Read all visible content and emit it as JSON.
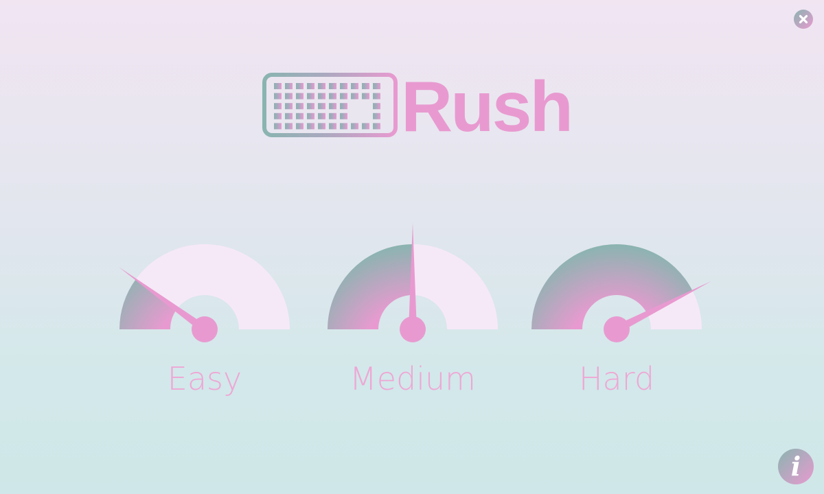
{
  "app": {
    "title": "Rush"
  },
  "colors": {
    "background_top": "#f1e5f2",
    "background_bottom": "#cfe7e8",
    "accent_pink": "#e89ad0",
    "accent_teal": "#8ab4b0",
    "track": "#f6e9f7",
    "label": "#efa6d5"
  },
  "toolbar": {
    "close_icon": "close-icon",
    "info_icon": "info-icon",
    "info_glyph": "i"
  },
  "logo": {
    "icon": "keyboard-icon",
    "text": "Rush"
  },
  "difficulty": {
    "levels": [
      {
        "label": "Easy",
        "level_fraction": 0.2
      },
      {
        "label": "Medium",
        "level_fraction": 0.5
      },
      {
        "label": "Hard",
        "level_fraction": 0.85
      }
    ]
  }
}
